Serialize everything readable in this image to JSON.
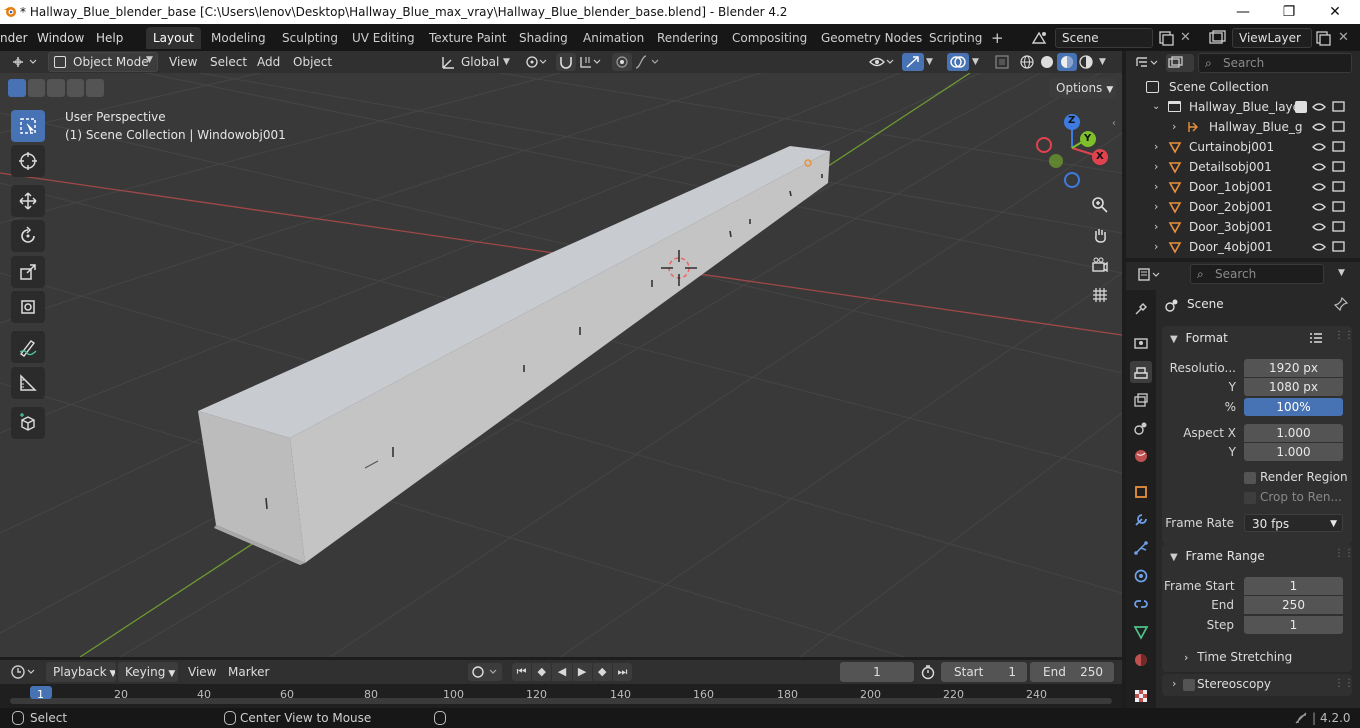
{
  "window": {
    "title": "* Hallway_Blue_blender_base [C:\\Users\\lenov\\Desktop\\Hallway_Blue_max_vray\\Hallway_Blue_blender_base.blend] - Blender 4.2",
    "controls": {
      "minimize": "—",
      "maximize": "❐",
      "close": "✕"
    }
  },
  "menu": {
    "items": [
      "nder",
      "Window",
      "Help"
    ],
    "workspaces": [
      "Layout",
      "Modeling",
      "Sculpting",
      "UV Editing",
      "Texture Paint",
      "Shading",
      "Animation",
      "Rendering",
      "Compositing",
      "Geometry Nodes",
      "Scripting"
    ],
    "active_workspace": "Layout",
    "add_tab": "+",
    "scene": "Scene",
    "view_layer": "ViewLayer"
  },
  "viewport_header": {
    "mode": "Object Mode",
    "menus": [
      "View",
      "Select",
      "Add",
      "Object"
    ],
    "transform_orientation": "Global",
    "options_label": "Options"
  },
  "viewport": {
    "perspective_label": "User Perspective",
    "collection_label": "(1) Scene Collection | Windowobj001",
    "gizmo": {
      "x": "X",
      "y": "Y",
      "z": "Z"
    }
  },
  "outliner": {
    "search_placeholder": "Search",
    "root": "Scene Collection",
    "items": [
      {
        "name": "Hallway_Blue_layer",
        "type": "collection"
      },
      {
        "name": "Hallway_Blue_g",
        "type": "object"
      },
      {
        "name": "Curtainobj001",
        "type": "mesh"
      },
      {
        "name": "Detailsobj001",
        "type": "mesh"
      },
      {
        "name": "Door_1obj001",
        "type": "mesh"
      },
      {
        "name": "Door_2obj001",
        "type": "mesh"
      },
      {
        "name": "Door_3obj001",
        "type": "mesh"
      },
      {
        "name": "Door_4obj001",
        "type": "mesh"
      }
    ]
  },
  "properties": {
    "search_placeholder": "Search",
    "context": "Scene",
    "format": {
      "title": "Format",
      "resolution_label": "Resolutio...",
      "resolution_x": "1920 px",
      "y_label": "Y",
      "resolution_y": "1080 px",
      "percent_label": "%",
      "percent": "100%",
      "aspect_x_label": "Aspect X",
      "aspect_x": "1.000",
      "aspect_y_label": "Y",
      "aspect_y": "1.000",
      "render_region": "Render Region",
      "crop": "Crop to Ren...",
      "frame_rate_label": "Frame Rate",
      "frame_rate": "30 fps"
    },
    "frame_range": {
      "title": "Frame Range",
      "start_label": "Frame Start",
      "start": "1",
      "end_label": "End",
      "end": "250",
      "step_label": "Step",
      "step": "1"
    },
    "time_stretching": "Time Stretching",
    "stereoscopy": "Stereoscopy"
  },
  "timeline": {
    "menus": [
      "Playback",
      "Keying",
      "View",
      "Marker"
    ],
    "current_frame": "1",
    "start_label": "Start",
    "start": "1",
    "end_label": "End",
    "end": "250",
    "ticks": [
      "1",
      "20",
      "40",
      "60",
      "80",
      "100",
      "120",
      "140",
      "160",
      "180",
      "200",
      "220",
      "240"
    ]
  },
  "status": {
    "select": "Select",
    "center_view": "Center View to Mouse",
    "version": "4.2.0"
  },
  "colors": {
    "accent": "#4772b3",
    "viewport_bg": "#393939",
    "panel_bg": "#282828",
    "mesh_orange": "#e8903c"
  }
}
